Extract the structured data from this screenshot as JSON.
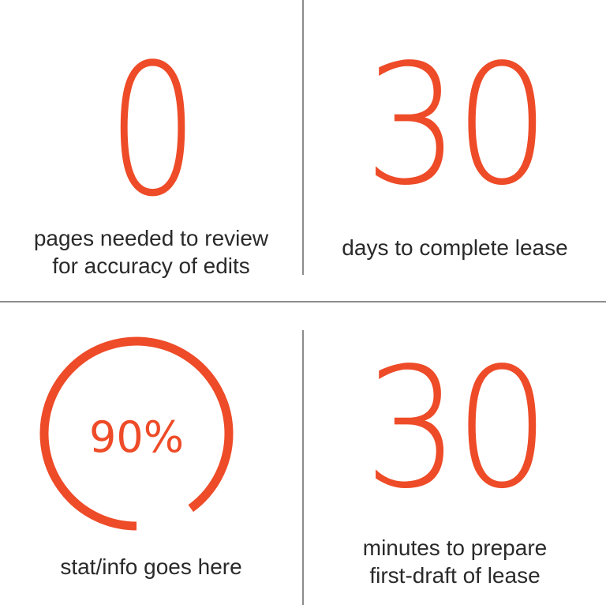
{
  "colors": {
    "accent": "#ee4b28",
    "text": "#2a2a2a",
    "divider": "#8c8c8c"
  },
  "stats": [
    {
      "value": "0",
      "lines": [
        "pages needed to review",
        "for accuracy of edits"
      ]
    },
    {
      "value": "30",
      "lines": [
        "days to complete lease"
      ]
    },
    {
      "value": "90%",
      "progress": 0.9,
      "lines": [
        "stat/info goes here"
      ]
    },
    {
      "value": "30",
      "lines": [
        "minutes to prepare",
        "first-draft of lease"
      ]
    }
  ]
}
